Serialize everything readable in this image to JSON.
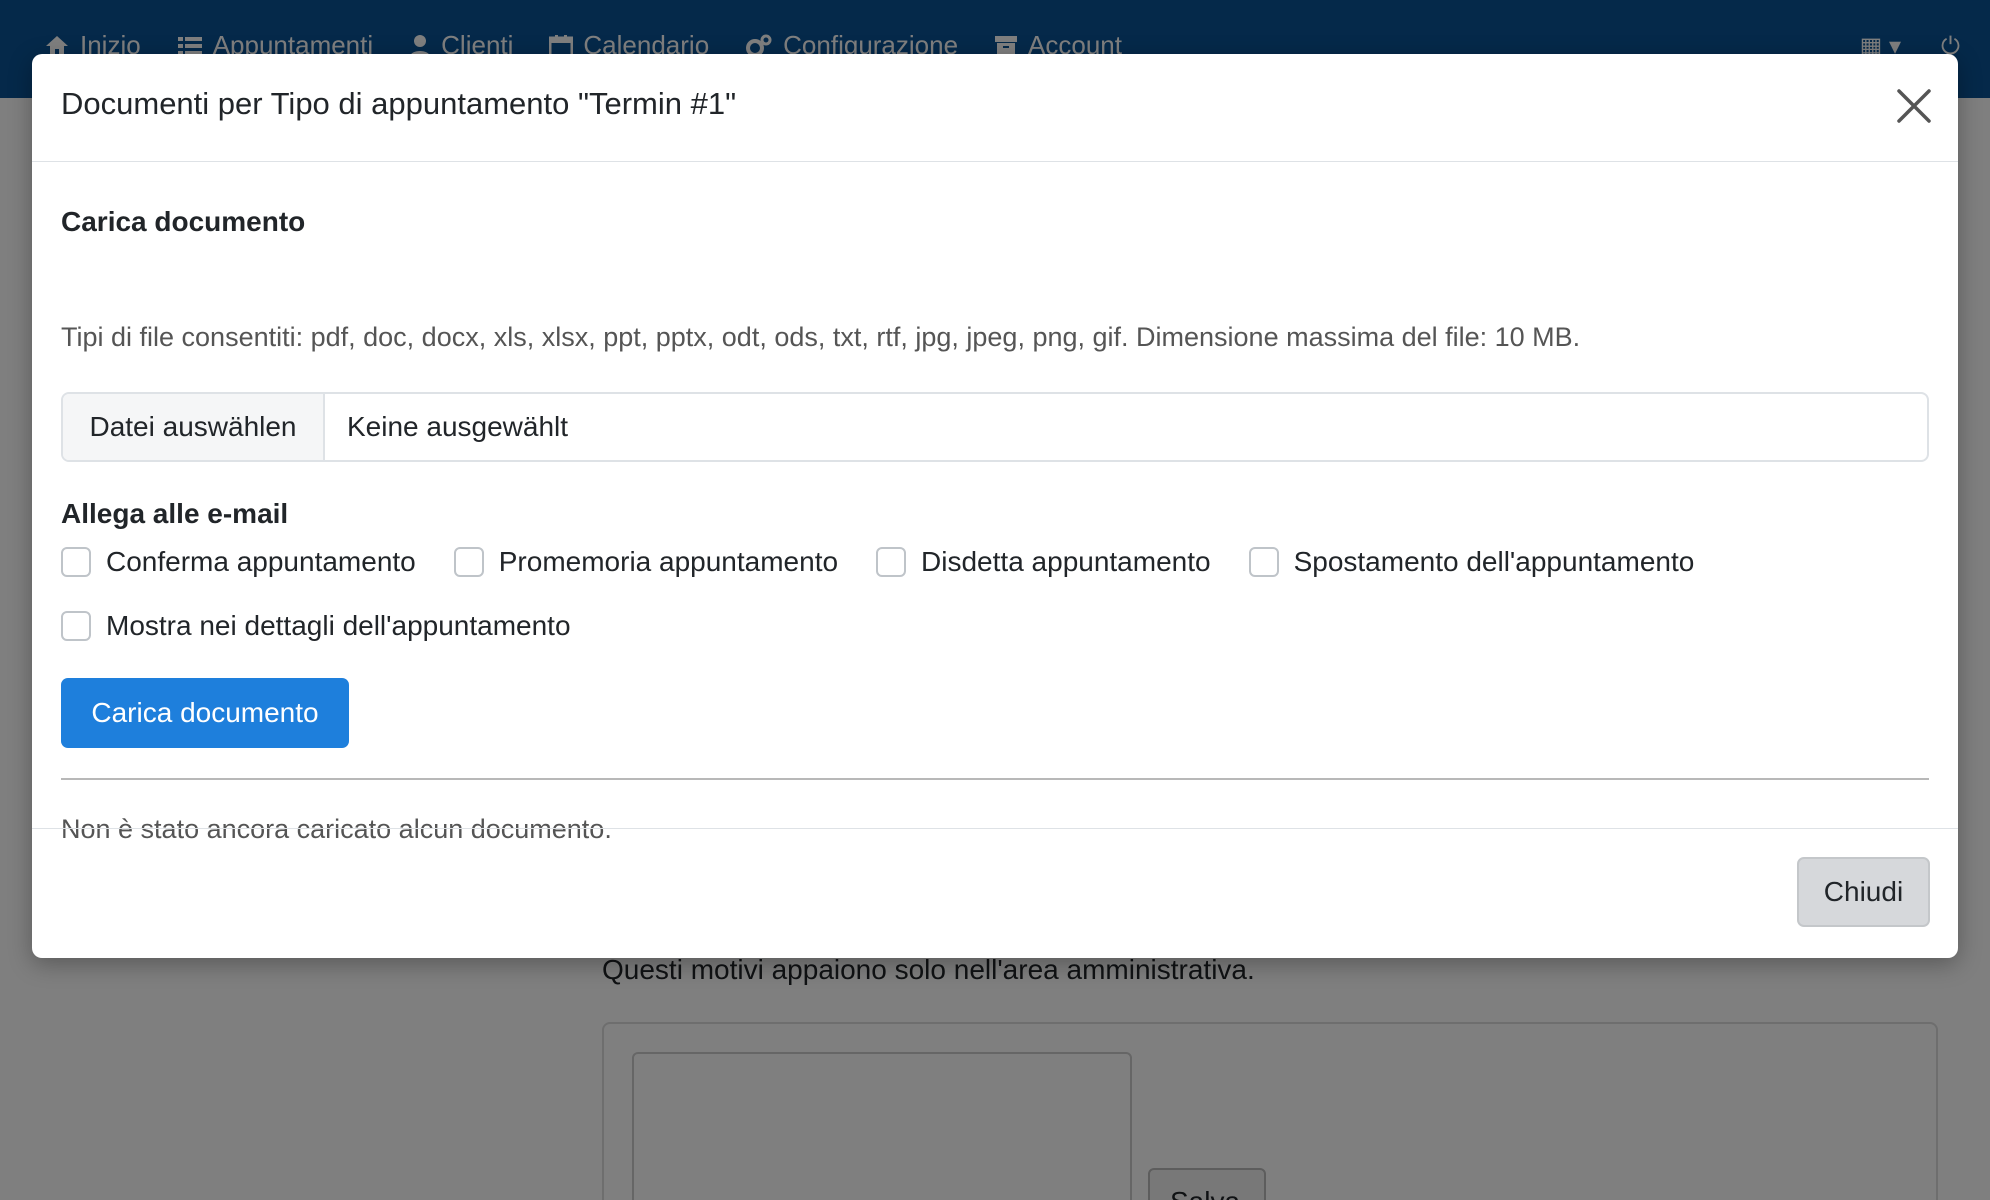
{
  "navbar": {
    "items": [
      {
        "label": "Inizio",
        "icon": "home-icon"
      },
      {
        "label": "Appuntamenti",
        "icon": "list-icon"
      },
      {
        "label": "Clienti",
        "icon": "user-icon"
      },
      {
        "label": "Calendario",
        "icon": "calendar-icon"
      },
      {
        "label": "Configurazione",
        "icon": "gear-icon"
      },
      {
        "label": "Account",
        "icon": "archive-icon"
      }
    ],
    "language_icon": "language-icon",
    "power_icon": "power-icon",
    "bg_color": "#0b5394"
  },
  "background": {
    "note": "Questi motivi appaiono solo nell'area amministrativa.",
    "save_label": "Salva"
  },
  "modal": {
    "title": "Documenti per Tipo di appuntamento \"Termin #1\"",
    "upload_section_title": "Carica documento",
    "allowed_types": "Tipi di file consentiti: pdf, doc, docx, xls, xlsx, ppt, pptx, odt, ods, txt, rtf, jpg, jpeg, png, gif. Dimensione massima del file: 10 MB.",
    "file_button_label": "Datei auswählen",
    "file_status": "Keine ausgewählt",
    "attach_section_title": "Allega alle e-mail",
    "checkboxes": [
      {
        "label": "Conferma appuntamento",
        "checked": false
      },
      {
        "label": "Promemoria appuntamento",
        "checked": false
      },
      {
        "label": "Disdetta appuntamento",
        "checked": false
      },
      {
        "label": "Spostamento dell'appuntamento",
        "checked": false
      }
    ],
    "show_in_details": {
      "label": "Mostra nei dettagli dell'appuntamento",
      "checked": false
    },
    "upload_button_label": "Carica documento",
    "empty_message": "Non è stato ancora caricato alcun documento.",
    "close_button_label": "Chiudi"
  },
  "colors": {
    "primary": "#1e7fdc",
    "secondary": "#d6d8db"
  }
}
